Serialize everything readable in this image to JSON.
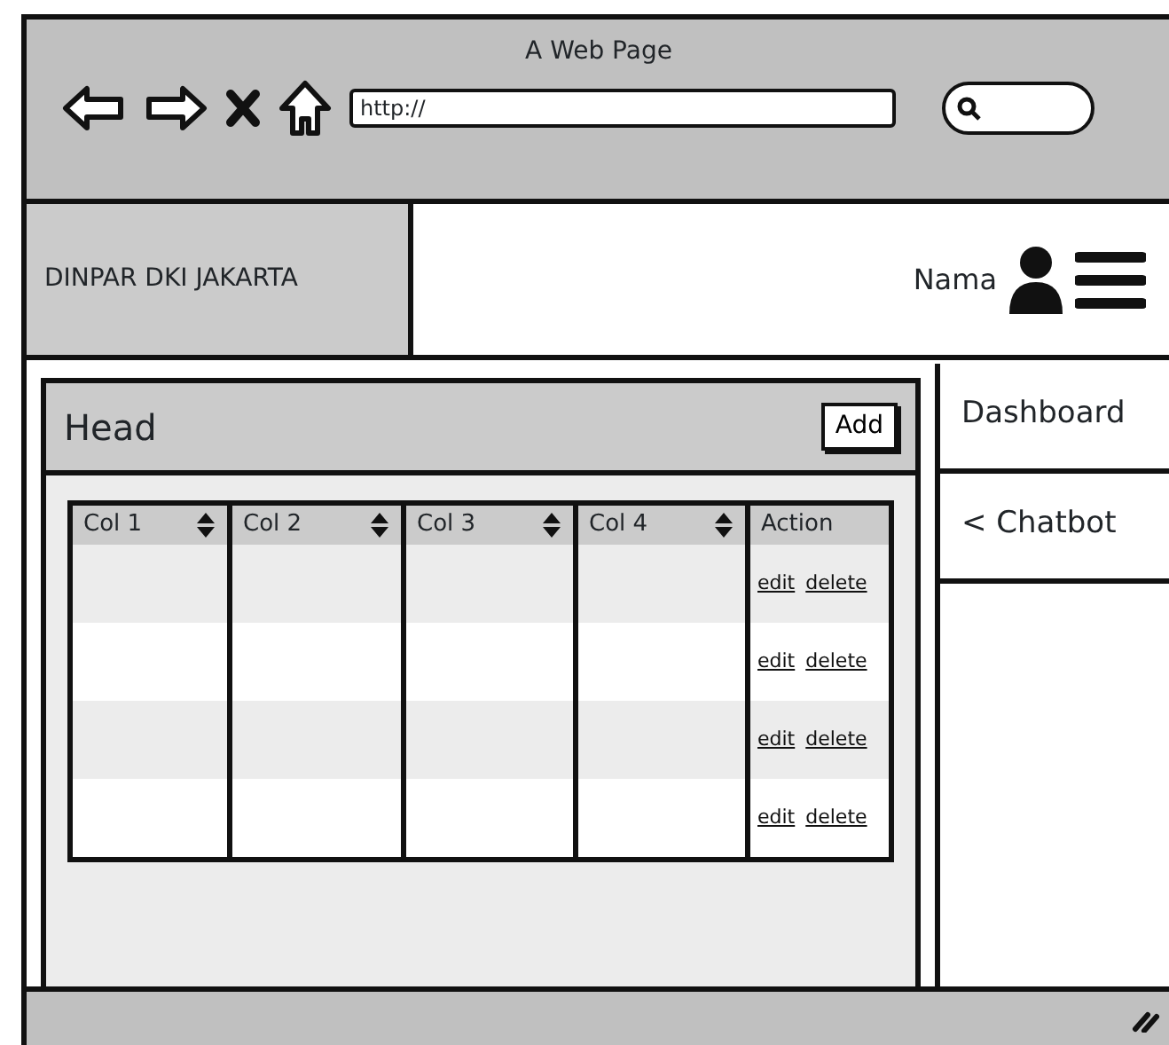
{
  "window": {
    "title": "A Web Page",
    "address": "http://"
  },
  "header": {
    "brand": "DINPAR DKI JAKARTA",
    "user_name": "Nama"
  },
  "panel": {
    "title": "Head",
    "add_button": "Add"
  },
  "table": {
    "columns": [
      {
        "label": "Col 1",
        "sortable": true
      },
      {
        "label": "Col 2",
        "sortable": true
      },
      {
        "label": "Col 3",
        "sortable": true
      },
      {
        "label": "Col 4",
        "sortable": true
      },
      {
        "label": "Action",
        "sortable": false
      }
    ],
    "rows": [
      {
        "actions": [
          "edit",
          "delete"
        ]
      },
      {
        "actions": [
          "edit",
          "delete"
        ]
      },
      {
        "actions": [
          "edit",
          "delete"
        ]
      },
      {
        "actions": [
          "edit",
          "delete"
        ]
      }
    ]
  },
  "sidebar": {
    "items": [
      {
        "label": "Dashboard"
      },
      {
        "label": "< Chatbot"
      }
    ]
  }
}
